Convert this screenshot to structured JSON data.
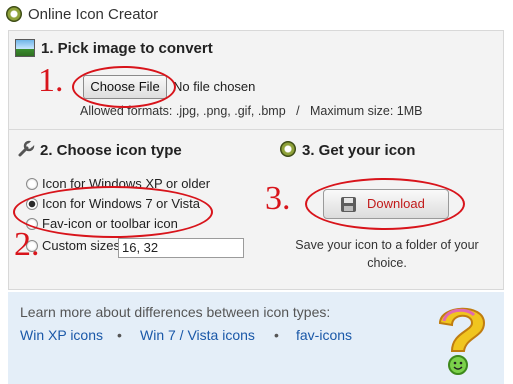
{
  "window": {
    "title": "Online Icon Creator"
  },
  "step1": {
    "title": "1. Pick image to convert",
    "choose_button": "Choose File",
    "file_status": "No file chosen",
    "allowed": "Allowed formats: .jpg, .png, .gif, .bmp   /   Maximum size: 1MB",
    "number": "1."
  },
  "step2": {
    "title": "2. Choose icon type",
    "options": [
      {
        "label": "Icon for Windows XP or older",
        "checked": false
      },
      {
        "label": "Icon for Windows 7 or Vista",
        "checked": true
      },
      {
        "label": "Fav-icon or toolbar icon",
        "checked": false
      }
    ],
    "custom_label": "Custom sizes",
    "custom_value": "16, 32",
    "number": "2."
  },
  "step3": {
    "title": "3. Get your icon",
    "download_button": "Download",
    "save_text": "Save your icon to a folder of your choice.",
    "number": "3."
  },
  "info": {
    "text": "Learn more about differences between icon types:",
    "links": [
      "Win XP icons",
      "Win 7 / Vista icons",
      "fav-icons"
    ],
    "bullet": "•"
  },
  "colors": {
    "annotation": "#d8141b",
    "link": "#1a58a8",
    "download_text": "#c11a1a"
  }
}
